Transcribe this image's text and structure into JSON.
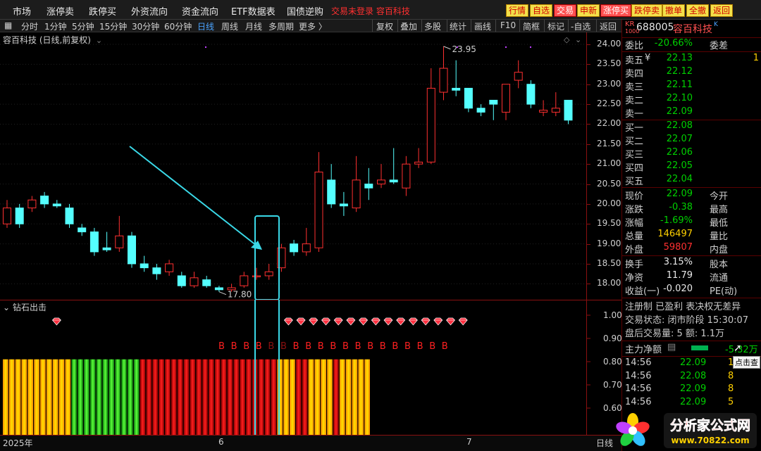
{
  "menu": [
    "市场",
    "涨停卖",
    "跌停买",
    "外资流向",
    "资金流向",
    "ETF数据表",
    "国债逆购"
  ],
  "ticker_text": "交易未登录  容百科技",
  "top_buttons": [
    "行情",
    "自选",
    "交易",
    "申新",
    "涨停买",
    "跌停卖",
    "撤单",
    "全撤",
    "返回"
  ],
  "periods": [
    "分时",
    "1分钟",
    "5分钟",
    "15分钟",
    "30分钟",
    "60分钟",
    "日线",
    "周线",
    "月线",
    "多周期",
    "更多 〉"
  ],
  "tools": [
    "复权",
    "叠加",
    "多股",
    "统计",
    "画线",
    "F10",
    "简框",
    "标记",
    "-自选",
    "返回"
  ],
  "chart_title": "容百科技 (日线,前复权)",
  "indicator_title": "钻石出击",
  "price_ticks": [
    "24.00",
    "23.50",
    "23.00",
    "22.50",
    "22.00",
    "21.50",
    "21.00",
    "20.50",
    "20.00",
    "19.50",
    "19.00",
    "18.50",
    "18.00"
  ],
  "sub_ticks": [
    "1.00",
    "0.90",
    "0.80",
    "0.70",
    "0.60"
  ],
  "annotations": {
    "high": "23.95",
    "low": "17.80"
  },
  "signal_letter": "B",
  "date_labels": [
    "2025年",
    "6",
    "7",
    "日线"
  ],
  "quote": {
    "badge": "KR",
    "code": "688005",
    "name": "容百科技",
    "suffix": "K",
    "weibi_label": "委比",
    "weibi_value": "-20.66%",
    "weicha_label": "委差",
    "sells": [
      {
        "label": "卖五",
        "price": "22.13",
        "vol": "1"
      },
      {
        "label": "卖四",
        "price": "22.12",
        "vol": ""
      },
      {
        "label": "卖三",
        "price": "22.11",
        "vol": ""
      },
      {
        "label": "卖二",
        "price": "22.10",
        "vol": ""
      },
      {
        "label": "卖一",
        "price": "22.09",
        "vol": ""
      }
    ],
    "buys": [
      {
        "label": "买一",
        "price": "22.08",
        "vol": ""
      },
      {
        "label": "买二",
        "price": "22.07",
        "vol": ""
      },
      {
        "label": "买三",
        "price": "22.06",
        "vol": ""
      },
      {
        "label": "买四",
        "price": "22.05",
        "vol": ""
      },
      {
        "label": "买五",
        "price": "22.04",
        "vol": ""
      }
    ],
    "stats1": [
      {
        "l": "现价",
        "v": "22.09",
        "c": "green",
        "l2": "今开"
      },
      {
        "l": "涨跌",
        "v": "-0.38",
        "c": "green",
        "l2": "最高"
      },
      {
        "l": "涨幅",
        "v": "-1.69%",
        "c": "green",
        "l2": "最低"
      },
      {
        "l": "总量",
        "v": "146497",
        "c": "yellow",
        "l2": "量比"
      },
      {
        "l": "外盘",
        "v": "59807",
        "c": "red",
        "l2": "内盘"
      }
    ],
    "stats2": [
      {
        "l": "换手",
        "v": "3.15%",
        "c": "white",
        "l2": "股本"
      },
      {
        "l": "净资",
        "v": "11.79",
        "c": "white",
        "l2": "流通"
      },
      {
        "l": "收益(一)",
        "v": "-0.020",
        "c": "white",
        "l2": "PE(动)"
      }
    ],
    "info1": "注册制  已盈利  表决权无差异",
    "info2": "交易状态: 闭市阶段 15:30:07",
    "info3": "盘后交易量: 5  额: 1.1万",
    "main_flow_label": "主力净额",
    "main_flow_value": "-5.32万",
    "click_hint": "点击查",
    "ticks": [
      {
        "t": "14:56",
        "p": "22.09",
        "v": "1"
      },
      {
        "t": "14:56",
        "p": "22.08",
        "v": "8"
      },
      {
        "t": "14:56",
        "p": "22.09",
        "v": "8"
      },
      {
        "t": "14:56",
        "p": "22.09",
        "v": "5"
      }
    ]
  },
  "logo": {
    "text": "分析家公式网",
    "url_text": "www.70822.com"
  },
  "colors": {
    "up": "#ff3030",
    "down": "#54ffff",
    "accent": "#4aa3ff",
    "highlight": "#3ad9e8"
  },
  "chart_data": {
    "type": "candlestick",
    "title": "容百科技 (日线,前复权)",
    "ylim": [
      17.6,
      24.3
    ],
    "candles": [
      {
        "o": 19.5,
        "c": 19.9,
        "h": 20.1,
        "l": 19.4
      },
      {
        "o": 19.9,
        "c": 19.5,
        "h": 20.0,
        "l": 19.4
      },
      {
        "o": 19.9,
        "c": 20.1,
        "h": 20.2,
        "l": 19.8
      },
      {
        "o": 20.2,
        "c": 20.0,
        "h": 20.3,
        "l": 19.9
      },
      {
        "o": 20.0,
        "c": 19.95,
        "h": 20.1,
        "l": 19.9
      },
      {
        "o": 19.9,
        "c": 19.5,
        "h": 20.0,
        "l": 19.4
      },
      {
        "o": 19.4,
        "c": 19.3,
        "h": 19.5,
        "l": 19.2
      },
      {
        "o": 19.3,
        "c": 18.8,
        "h": 19.4,
        "l": 18.7
      },
      {
        "o": 18.9,
        "c": 18.85,
        "h": 19.3,
        "l": 18.8
      },
      {
        "o": 18.9,
        "c": 19.2,
        "h": 19.7,
        "l": 18.8
      },
      {
        "o": 19.2,
        "c": 18.5,
        "h": 19.3,
        "l": 18.4
      },
      {
        "o": 18.5,
        "c": 18.4,
        "h": 18.7,
        "l": 18.3
      },
      {
        "o": 18.4,
        "c": 18.25,
        "h": 18.5,
        "l": 18.1
      },
      {
        "o": 18.3,
        "c": 18.5,
        "h": 18.6,
        "l": 18.2
      },
      {
        "o": 18.2,
        "c": 17.95,
        "h": 18.3,
        "l": 17.9
      },
      {
        "o": 17.95,
        "c": 18.15,
        "h": 18.3,
        "l": 17.9
      },
      {
        "o": 18.1,
        "c": 17.95,
        "h": 18.2,
        "l": 17.9
      },
      {
        "o": 17.9,
        "c": 17.85,
        "h": 17.95,
        "l": 17.8
      },
      {
        "o": 17.85,
        "c": 17.9,
        "h": 18.0,
        "l": 17.8
      },
      {
        "o": 17.95,
        "c": 18.2,
        "h": 18.3,
        "l": 17.9
      },
      {
        "o": 18.2,
        "c": 18.2,
        "h": 18.4,
        "l": 18.1
      },
      {
        "o": 18.2,
        "c": 18.3,
        "h": 18.5,
        "l": 18.1
      },
      {
        "o": 18.4,
        "c": 18.9,
        "h": 19.0,
        "l": 18.3
      },
      {
        "o": 19.0,
        "c": 18.8,
        "h": 19.1,
        "l": 18.7
      },
      {
        "o": 18.8,
        "c": 19.0,
        "h": 19.4,
        "l": 18.7
      },
      {
        "o": 18.9,
        "c": 20.8,
        "h": 21.3,
        "l": 18.8
      },
      {
        "o": 20.6,
        "c": 20.0,
        "h": 21.0,
        "l": 19.9
      },
      {
        "o": 20.0,
        "c": 19.95,
        "h": 20.3,
        "l": 19.7
      },
      {
        "o": 19.9,
        "c": 20.6,
        "h": 21.2,
        "l": 19.8
      },
      {
        "o": 20.5,
        "c": 20.4,
        "h": 20.9,
        "l": 20.1
      },
      {
        "o": 20.5,
        "c": 20.6,
        "h": 21.0,
        "l": 20.4
      },
      {
        "o": 20.6,
        "c": 20.55,
        "h": 21.4,
        "l": 20.5
      },
      {
        "o": 20.4,
        "c": 21.0,
        "h": 21.2,
        "l": 20.2
      },
      {
        "o": 21.0,
        "c": 21.05,
        "h": 21.4,
        "l": 20.9
      },
      {
        "o": 21.05,
        "c": 22.9,
        "h": 23.4,
        "l": 21.0
      },
      {
        "o": 22.8,
        "c": 23.4,
        "h": 23.95,
        "l": 22.6
      },
      {
        "o": 22.9,
        "c": 22.85,
        "h": 23.6,
        "l": 22.7
      },
      {
        "o": 22.9,
        "c": 22.4,
        "h": 22.9,
        "l": 22.3
      },
      {
        "o": 22.4,
        "c": 22.3,
        "h": 22.5,
        "l": 22.2
      },
      {
        "o": 22.6,
        "c": 22.5,
        "h": 22.6,
        "l": 22.1
      },
      {
        "o": 22.3,
        "c": 23.0,
        "h": 23.0,
        "l": 22.1
      },
      {
        "o": 23.1,
        "c": 23.3,
        "h": 23.6,
        "l": 22.9
      },
      {
        "o": 23.0,
        "c": 22.5,
        "h": 23.1,
        "l": 22.4
      },
      {
        "o": 22.3,
        "c": 22.35,
        "h": 22.6,
        "l": 22.2
      },
      {
        "o": 22.3,
        "c": 22.4,
        "h": 22.8,
        "l": 22.2
      },
      {
        "o": 22.6,
        "c": 22.1,
        "h": 22.6,
        "l": 22.0
      }
    ],
    "signal_bars": [
      "y",
      "y",
      "y",
      "y",
      "y",
      "y",
      "y",
      "y",
      "y",
      "y",
      "y",
      "g",
      "g",
      "g",
      "g",
      "g",
      "g",
      "g",
      "g",
      "g",
      "g",
      "g",
      "r",
      "r",
      "r",
      "r",
      "r",
      "r",
      "r",
      "r",
      "r",
      "r",
      "r",
      "r",
      "r",
      "r",
      "r",
      "r",
      "r",
      "r",
      "r",
      "r",
      "r",
      "r",
      "y",
      "y",
      "y",
      "r",
      "r",
      "y",
      "y",
      "y",
      "y",
      "r",
      "y",
      "y",
      "y",
      "y",
      "y"
    ],
    "diamond_positions": [
      2,
      22,
      23,
      24,
      25,
      26,
      27,
      28,
      29,
      30,
      31,
      32,
      33,
      34,
      35,
      36
    ]
  }
}
